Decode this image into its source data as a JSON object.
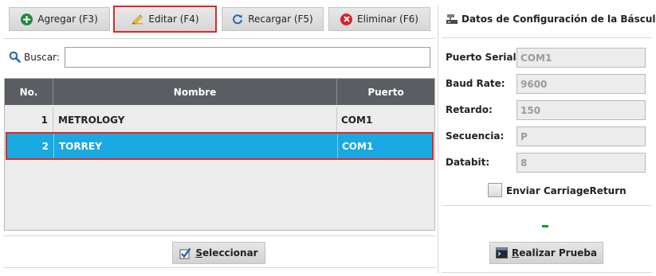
{
  "toolbar": {
    "add_label": "Agregar (F3)",
    "edit_label": "Editar (F4)",
    "reload_label": "Recargar (F5)",
    "delete_label": "Eliminar (F6)"
  },
  "search": {
    "label": "Buscar:",
    "value": "",
    "placeholder": ""
  },
  "table": {
    "columns": [
      "No.",
      "Nombre",
      "Puerto"
    ],
    "rows": [
      {
        "no": "1",
        "nombre": "METROLOGY",
        "puerto": "COM1"
      },
      {
        "no": "2",
        "nombre": "TORREY",
        "puerto": "COM1"
      }
    ]
  },
  "select_button": {
    "first_letter": "S",
    "rest": "eleccionar"
  },
  "panel": {
    "title": "Datos de Configuración de la Báscula",
    "fields": [
      {
        "label": "Puerto Serial:",
        "value": "COM1"
      },
      {
        "label": "Baud Rate:",
        "value": "9600"
      },
      {
        "label": "Retardo:",
        "value": "150"
      },
      {
        "label": "Secuencia:",
        "value": "P"
      },
      {
        "label": "Databit:",
        "value": "8"
      }
    ],
    "checkbox_label": "Enviar CarriageReturn",
    "test_button": {
      "first_letter": "R",
      "rest": "ealizar Prueba"
    }
  },
  "colors": {
    "selected_row": "#1aa9e0",
    "header_bg": "#5a5e62",
    "focus_border": "#d92a2a",
    "add_icon": "#1f8a3c",
    "delete_icon": "#d4242a",
    "status_mark": "#1a9a2a"
  },
  "icons": {
    "add": "plus-circle-icon",
    "edit": "pencil-icon",
    "reload": "refresh-icon",
    "delete": "x-circle-icon",
    "search": "magnifier-icon",
    "panel": "scale-icon",
    "select": "checkmark-icon",
    "test": "terminal-icon"
  }
}
